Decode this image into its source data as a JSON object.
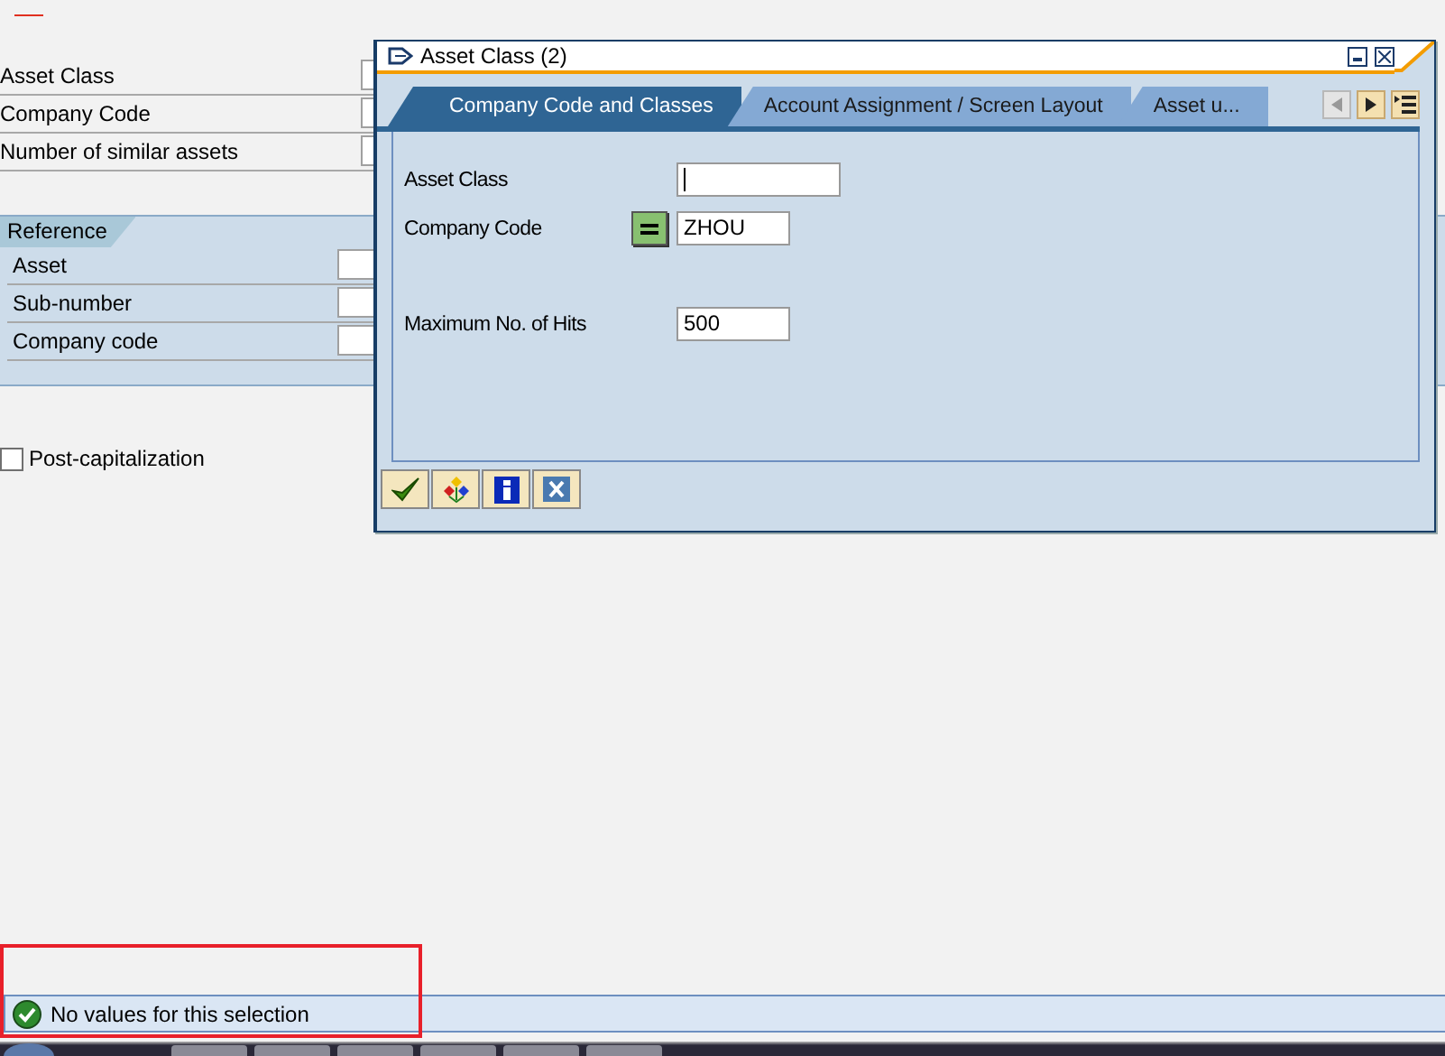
{
  "form": {
    "fields": [
      {
        "label": "Asset Class"
      },
      {
        "label": "Company Code"
      },
      {
        "label": "Number of similar assets"
      }
    ],
    "reference": {
      "title": "Reference",
      "fields": [
        {
          "label": "Asset"
        },
        {
          "label": "Sub-number"
        },
        {
          "label": "Company code"
        }
      ]
    },
    "post_capitalization": {
      "label": "Post-capitalization",
      "checked": false
    }
  },
  "dialog": {
    "title": "Asset Class (2)",
    "tabs": [
      {
        "label": "Company Code and Classes",
        "selected": true
      },
      {
        "label": "Account Assignment / Screen Layout",
        "selected": false
      },
      {
        "label": "Asset u...",
        "selected": false
      }
    ],
    "tab_nav": [
      {
        "kind": "prev",
        "disabled": true
      },
      {
        "kind": "next",
        "disabled": false
      },
      {
        "kind": "list",
        "disabled": false
      }
    ],
    "fields": [
      {
        "label": "Asset Class",
        "focused": true,
        "operator": false
      },
      {
        "label": "Company Code",
        "value": "ZHOU",
        "focused": false,
        "operator": true
      },
      {
        "label": "Maximum No. of Hits",
        "value": "500",
        "focused": false,
        "operator": false
      }
    ],
    "buttons": [
      {
        "kind": "confirm"
      },
      {
        "kind": "hierarchy"
      },
      {
        "kind": "info"
      },
      {
        "kind": "cancel"
      }
    ]
  },
  "status_bar": {
    "message": "No values for this selection",
    "highlighted": true
  }
}
